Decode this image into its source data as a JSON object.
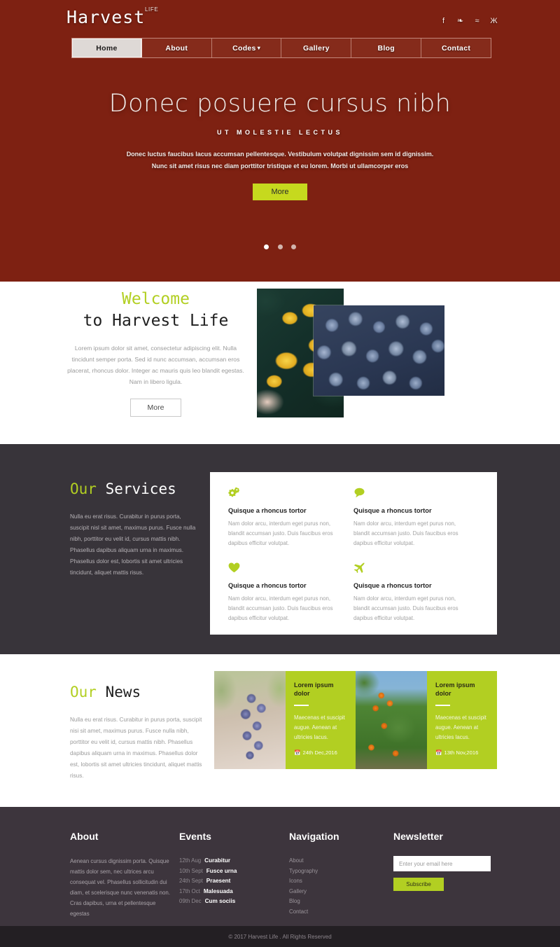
{
  "header": {
    "logo": "Harvest",
    "logo_sub": "LIFE",
    "social": [
      {
        "name": "facebook-icon",
        "glyph": "f"
      },
      {
        "name": "twitter-icon",
        "glyph": "❧"
      },
      {
        "name": "rss-icon",
        "glyph": "≈"
      },
      {
        "name": "vk-icon",
        "glyph": "Ж"
      }
    ],
    "nav": [
      {
        "label": "Home",
        "active": true
      },
      {
        "label": "About",
        "active": false
      },
      {
        "label": "Codes",
        "active": false,
        "caret": "▾"
      },
      {
        "label": "Gallery",
        "active": false
      },
      {
        "label": "Blog",
        "active": false
      },
      {
        "label": "Contact",
        "active": false
      }
    ]
  },
  "hero": {
    "title": "Donec posuere cursus nibh",
    "subtitle": "UT MOLESTIE LECTUS",
    "description": "Donec luctus faucibus lacus accumsan pellentesque. Vestibulum volutpat dignissim sem id dignissim. Nunc sit amet risus nec diam porttitor tristique et eu lorem. Morbi ut ullamcorper eros",
    "button": "More",
    "slides": 3,
    "active_slide": 1,
    "accent": "#c6d91e"
  },
  "welcome": {
    "heading_top": "Welcome",
    "heading_bottom": "to Harvest Life",
    "paragraph": "Lorem ipsum dolor sit amet, consectetur adipiscing elit. Nulla tincidunt semper porta. Sed id nunc accumsan, accumsan eros placerat, rhoncus dolor. Integer ac mauris quis leo blandit egestas. Nam in libero ligula.",
    "button": "More",
    "image_back": "lemons-photo",
    "image_front": "blueberries-photo"
  },
  "services": {
    "heading_accent": "Our",
    "heading_rest": "Services",
    "paragraph": "Nulla eu erat risus. Curabitur in purus porta, suscipit nisl sit amet, maximus purus. Fusce nulla nibh, porttitor eu velit id, cursus mattis nibh. Phasellus dapibus aliquam urna in maximus. Phasellus dolor est, lobortis sit amet ultricies tincidunt, aliquet mattis risus.",
    "items": [
      {
        "icon": "gears-icon",
        "title": "Quisque a rhoncus tortor",
        "text": "Nam dolor arcu, interdum eget purus non, blandit accumsan justo. Duis faucibus eros dapibus efficitur volutpat."
      },
      {
        "icon": "comment-icon",
        "title": "Quisque a rhoncus tortor",
        "text": "Nam dolor arcu, interdum eget purus non, blandit accumsan justo. Duis faucibus eros dapibus efficitur volutpat."
      },
      {
        "icon": "heart-icon",
        "title": "Quisque a rhoncus tortor",
        "text": "Nam dolor arcu, interdum eget purus non, blandit accumsan justo. Duis faucibus eros dapibus efficitur volutpat."
      },
      {
        "icon": "plane-icon",
        "title": "Quisque a rhoncus tortor",
        "text": "Nam dolor arcu, interdum eget purus non, blandit accumsan justo. Duis faucibus eros dapibus efficitur volutpat."
      }
    ]
  },
  "news": {
    "heading_accent": "Our",
    "heading_rest": "News",
    "paragraph": "Nulla eu erat risus. Curabitur in purus porta, suscipit nisi sit amet, maximus purus. Fusce nulla nibh, porttitor eu velit id, cursus mattis nibh. Phasellus dapibus aliquam urna in maximus. Phasellus dolor est, lobortis sit amet ultricies tincidunt, aliquet mattis risus.",
    "cards": [
      {
        "image": "grapes-photo",
        "title": "Lorem ipsum dolor",
        "text": "Maecenas et suscipit augue. Aenean at ultricies lacus.",
        "date": "24th Dec,2016",
        "cal_icon": "calendar-icon"
      },
      {
        "image": "oranges-photo",
        "title": "Lorem ipsum dolor",
        "text": "Maecenas et suscipit augue. Aenean at ultricies lacus.",
        "date": "13th Nov,2016",
        "cal_icon": "calendar-icon"
      }
    ]
  },
  "footer": {
    "about": {
      "title": "About",
      "text": "Aenean cursus dignissim porta. Quisque mattis dolor sem, nec ultrices arcu consequat vel. Phasellus sollicitudin dui diam, et scelerisque nunc venenatis non. Cras dapibus, urna et pellentesque egestas"
    },
    "events": {
      "title": "Events",
      "items": [
        {
          "date": "12th Aug",
          "name": "Curabitur"
        },
        {
          "date": "10th Sept",
          "name": "Fusce urna"
        },
        {
          "date": "24th Sept",
          "name": "Praesent"
        },
        {
          "date": "17th Oct",
          "name": "Malesuada"
        },
        {
          "date": "09th Dec",
          "name": "Cum sociis"
        }
      ]
    },
    "navigation": {
      "title": "Navigation",
      "items": [
        "About",
        "Typography",
        "Icons",
        "Gallery",
        "Blog",
        "Contact"
      ]
    },
    "newsletter": {
      "title": "Newsletter",
      "placeholder": "Enter your email here",
      "value": "",
      "button": "Subscribe"
    },
    "copyright": "© 2017 Harvest Life . All Rights Reserved"
  }
}
